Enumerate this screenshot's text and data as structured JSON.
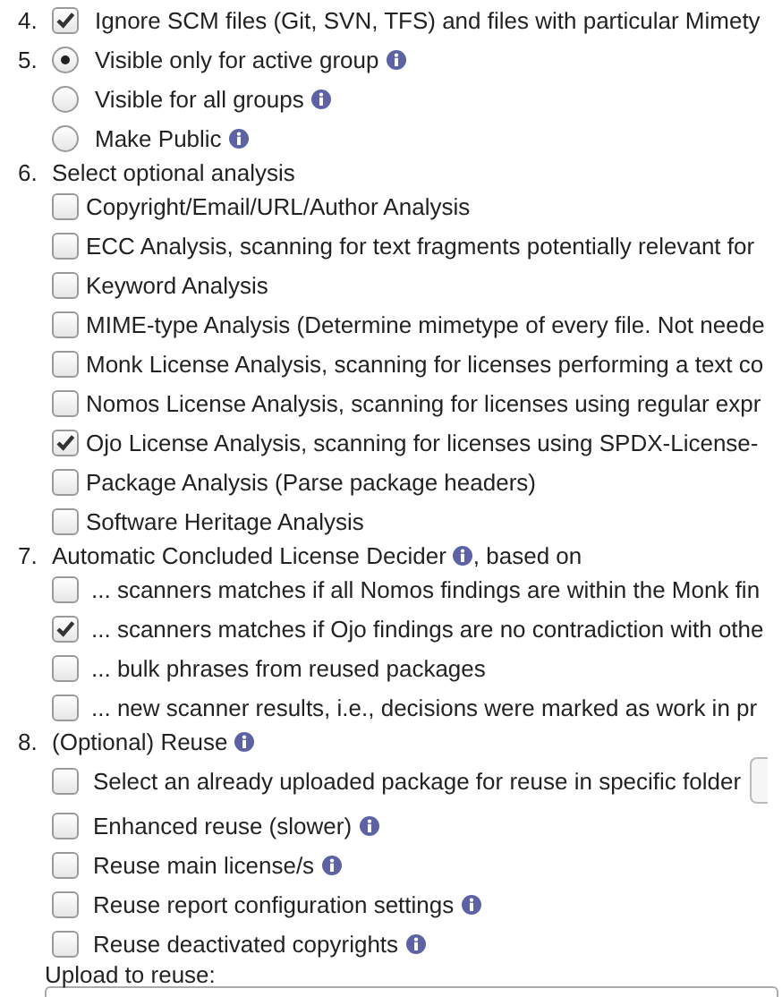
{
  "sections": [
    {
      "number": "4.",
      "kind": "checkbox",
      "checked": true,
      "label": "Ignore SCM files (Git, SVN, TFS) and files with particular Mimety"
    },
    {
      "number": "5.",
      "kind": "radios",
      "options": [
        {
          "label": "Visible only for active group",
          "selected": true,
          "info": true
        },
        {
          "label": "Visible for all groups",
          "selected": false,
          "info": true
        },
        {
          "label": "Make Public",
          "selected": false,
          "info": true
        }
      ]
    },
    {
      "number": "6.",
      "kind": "checklist",
      "title": "Select optional analysis",
      "items": [
        {
          "label": "Copyright/Email/URL/Author Analysis",
          "checked": false
        },
        {
          "label": "ECC Analysis, scanning for text fragments potentially relevant for",
          "checked": false
        },
        {
          "label": "Keyword Analysis",
          "checked": false
        },
        {
          "label": "MIME-type Analysis (Determine mimetype of every file. Not neede",
          "checked": false
        },
        {
          "label": "Monk License Analysis, scanning for licenses performing a text co",
          "checked": false
        },
        {
          "label": "Nomos License Analysis, scanning for licenses using regular expr",
          "checked": false
        },
        {
          "label": "Ojo License Analysis, scanning for licenses using SPDX-License-",
          "checked": true
        },
        {
          "label": "Package Analysis (Parse package headers)",
          "checked": false
        },
        {
          "label": "Software Heritage Analysis",
          "checked": false
        }
      ]
    },
    {
      "number": "7.",
      "kind": "checklist",
      "title": "Automatic Concluded License Decider",
      "info": true,
      "title_after": ", based on",
      "items": [
        {
          "label": "... scanners matches if all Nomos findings are within the Monk fin",
          "checked": false
        },
        {
          "label": "... scanners matches if Ojo findings are no contradiction with othe",
          "checked": true
        },
        {
          "label": "... bulk phrases from reused packages",
          "checked": false
        },
        {
          "label": "... new scanner results, i.e., decisions were marked as work in pr",
          "checked": false
        }
      ]
    },
    {
      "number": "8.",
      "kind": "checklist",
      "title": "(Optional) Reuse",
      "info": true,
      "items": [
        {
          "label": "Select an already uploaded package for reuse in specific folder",
          "checked": false,
          "folder_select": true
        },
        {
          "label": "Enhanced reuse (slower)",
          "checked": false,
          "info": true
        },
        {
          "label": "Reuse main license/s",
          "checked": false,
          "info": true
        },
        {
          "label": "Reuse report configuration settings",
          "checked": false,
          "info": true
        },
        {
          "label": "Reuse deactivated copyrights",
          "checked": false,
          "info": true
        }
      ],
      "upload_label": "Upload to reuse:"
    }
  ]
}
